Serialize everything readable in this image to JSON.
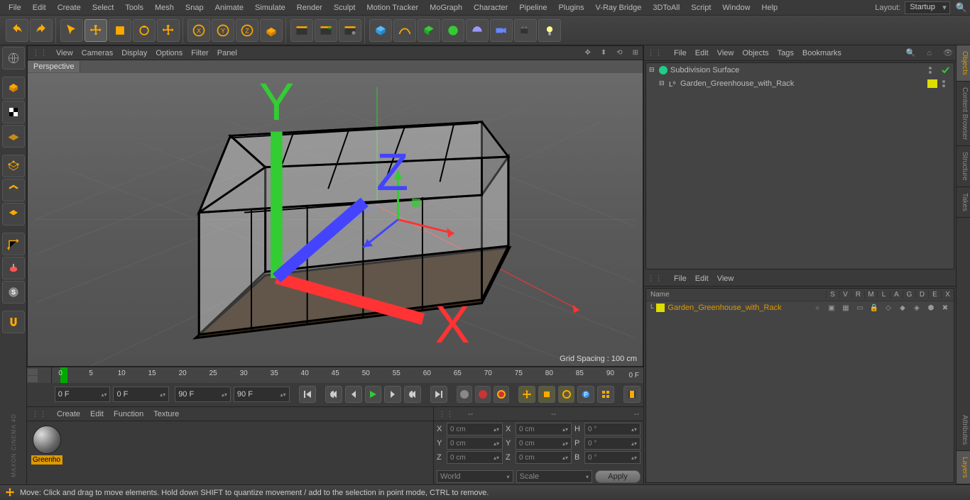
{
  "menubar": {
    "items": [
      "File",
      "Edit",
      "Create",
      "Select",
      "Tools",
      "Mesh",
      "Snap",
      "Animate",
      "Simulate",
      "Render",
      "Sculpt",
      "Motion Tracker",
      "MoGraph",
      "Character",
      "Pipeline",
      "Plugins",
      "V-Ray Bridge",
      "3DToAll",
      "Script",
      "Window",
      "Help"
    ],
    "layout_label": "Layout:",
    "layout_value": "Startup"
  },
  "viewport_menu": [
    "View",
    "Cameras",
    "Display",
    "Options",
    "Filter",
    "Panel"
  ],
  "viewport_tab": "Perspective",
  "grid_spacing": "Grid Spacing : 100 cm",
  "timeline": {
    "ticks": [
      "0",
      "5",
      "10",
      "15",
      "20",
      "25",
      "30",
      "35",
      "40",
      "45",
      "50",
      "55",
      "60",
      "65",
      "70",
      "75",
      "80",
      "85",
      "90"
    ],
    "end_label": "0 F",
    "inputs": [
      "0 F",
      "0 F",
      "90 F",
      "90 F"
    ]
  },
  "material_menu": [
    "Create",
    "Edit",
    "Function",
    "Texture"
  ],
  "material_name": "Greenho",
  "coords": {
    "head": [
      "--",
      "--",
      "--"
    ],
    "rows": [
      {
        "l": "X",
        "v1": "0 cm",
        "l2": "X",
        "v2": "0 cm",
        "l3": "H",
        "v3": "0 °"
      },
      {
        "l": "Y",
        "v1": "0 cm",
        "l2": "Y",
        "v2": "0 cm",
        "l3": "P",
        "v3": "0 °"
      },
      {
        "l": "Z",
        "v1": "0 cm",
        "l2": "Z",
        "v2": "0 cm",
        "l3": "B",
        "v3": "0 °"
      }
    ],
    "sel1": "World",
    "sel2": "Scale",
    "apply": "Apply"
  },
  "objects_panel": {
    "menu": [
      "File",
      "Edit",
      "View",
      "Objects",
      "Tags",
      "Bookmarks"
    ],
    "tree": [
      {
        "name": "Subdivision Surface",
        "icon": "subdiv",
        "child": false
      },
      {
        "name": "Garden_Greenhouse_with_Rack",
        "icon": "null",
        "child": true
      }
    ]
  },
  "layers_panel": {
    "menu": [
      "File",
      "Edit",
      "View"
    ],
    "header_name": "Name",
    "cols": [
      "S",
      "V",
      "R",
      "M",
      "L",
      "A",
      "G",
      "D",
      "E",
      "X"
    ],
    "row_name": "Garden_Greenhouse_with_Rack"
  },
  "right_tabs": [
    "Objects",
    "Content Browser",
    "Structure",
    "Takes",
    "Attributes",
    "Layers"
  ],
  "status": "Move: Click and drag to move elements. Hold down SHIFT to quantize movement / add to the selection in point mode, CTRL to remove.",
  "brand": "MAXON CINEMA 4D"
}
